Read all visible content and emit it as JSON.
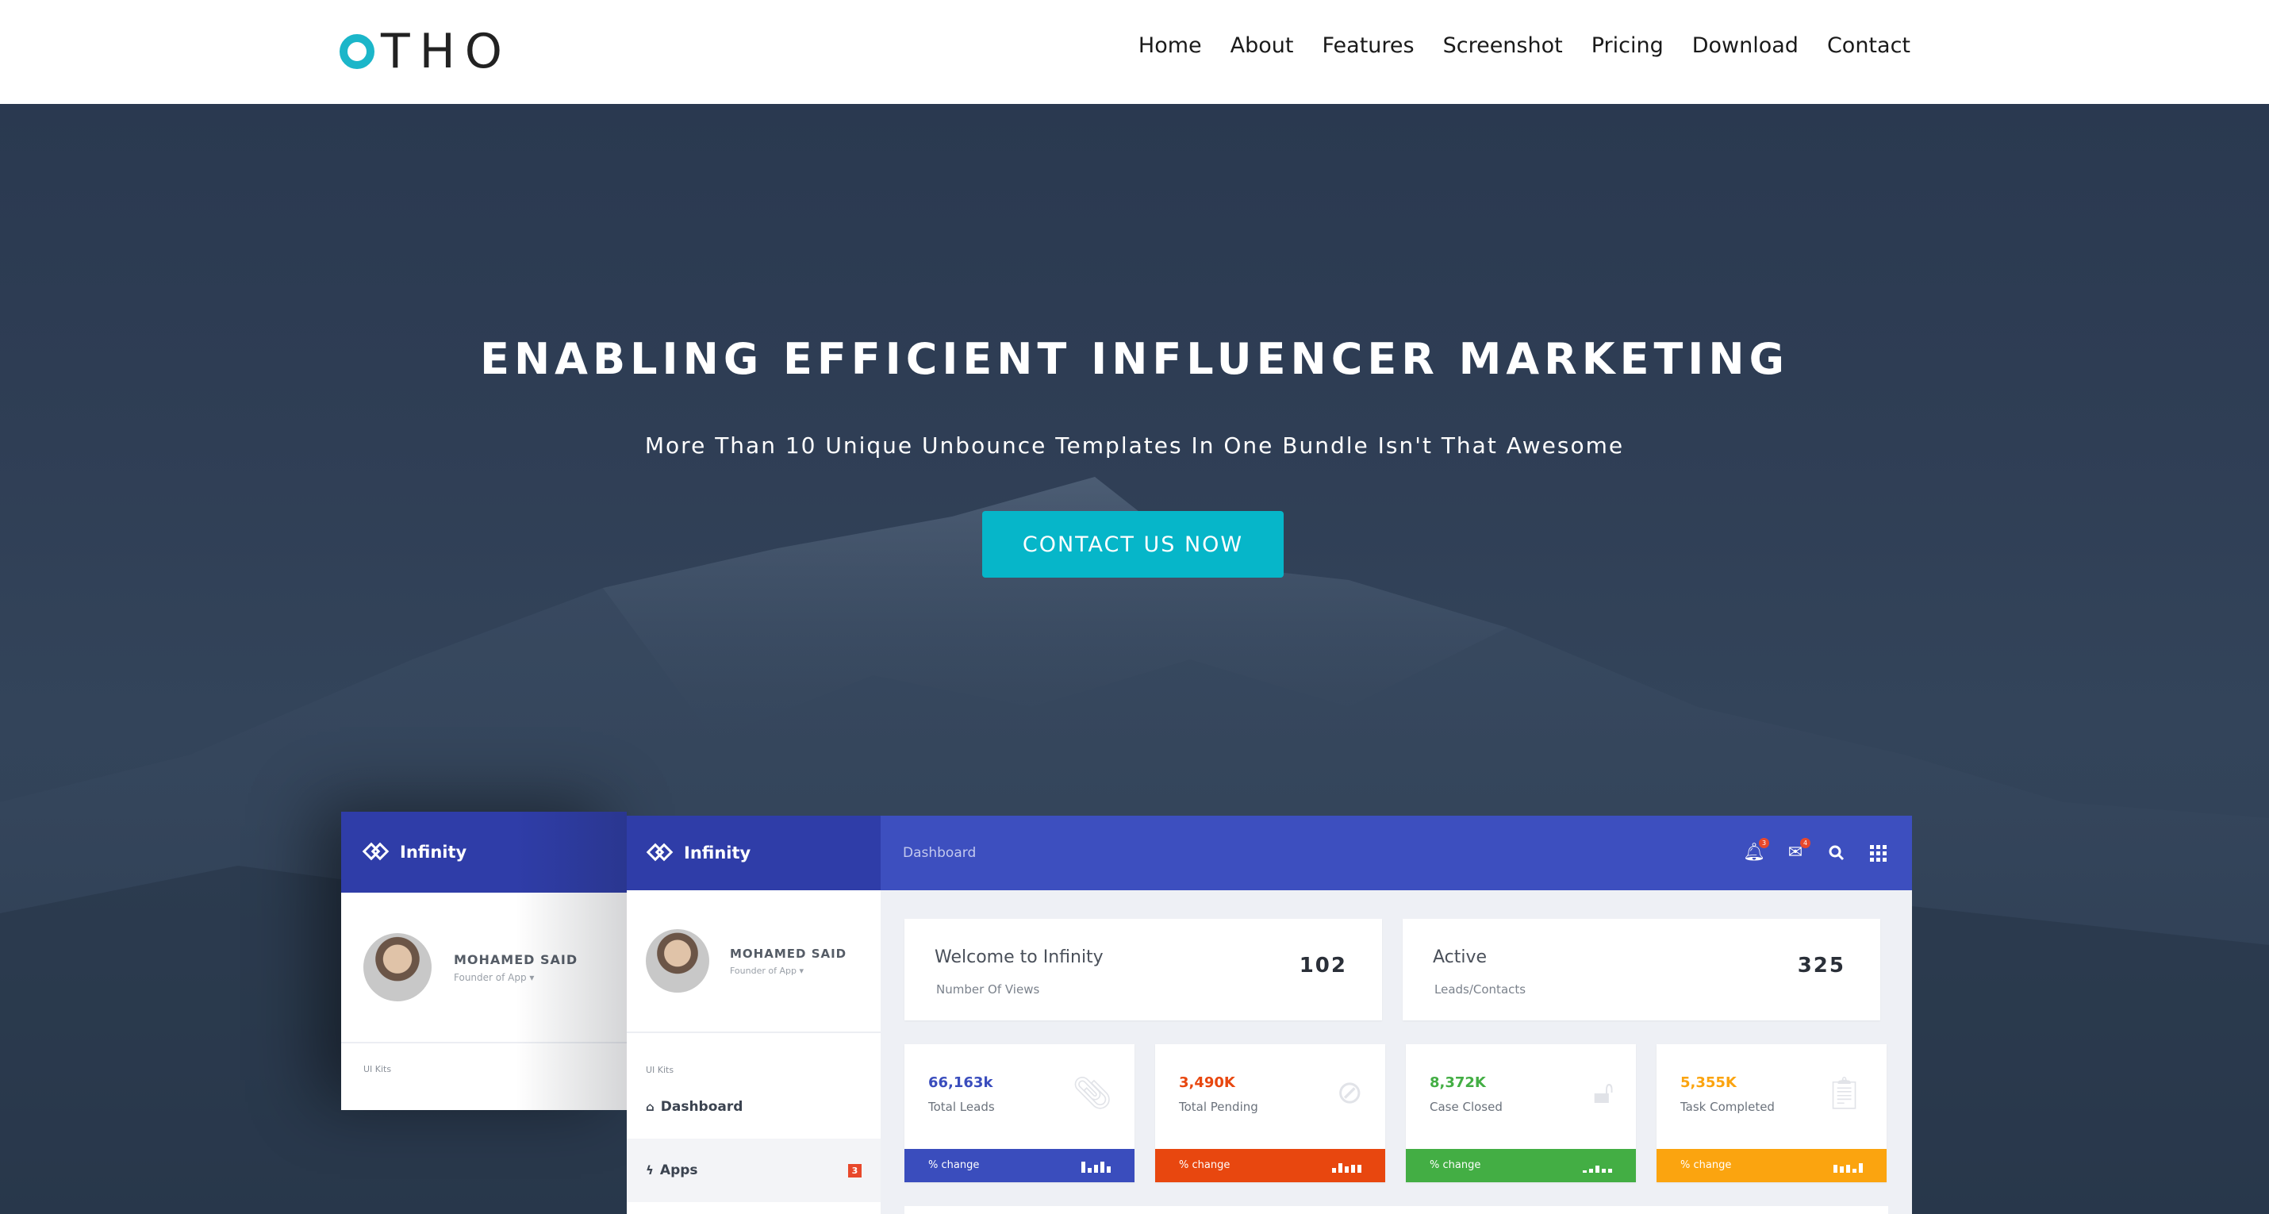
{
  "brand": {
    "logo_text": "THO",
    "accent": "#1bb6c9"
  },
  "nav": {
    "items": [
      {
        "label": "Home"
      },
      {
        "label": "About"
      },
      {
        "label": "Features"
      },
      {
        "label": "Screenshot"
      },
      {
        "label": "Pricing"
      },
      {
        "label": "Download"
      },
      {
        "label": "Contact"
      }
    ]
  },
  "hero": {
    "title": "ENABLING EFFICIENT INFLUENCER MARKETING",
    "subtitle": "More Than 10 Unique Unbounce Templates In One Bundle Isn't That Awesome",
    "cta_label": "CONTACT US NOW",
    "cta_color": "#06b6c9"
  },
  "dashboard": {
    "brand": "Infinity",
    "breadcrumb": "Dashboard",
    "notif_count": "3",
    "mail_count": "4",
    "profile": {
      "name": "MOHAMED SAID",
      "role": "Founder of App ▾"
    },
    "sidebar": {
      "section": "UI Kits",
      "items": [
        {
          "label": "Dashboard",
          "glyph": "⌂"
        },
        {
          "label": "Apps",
          "glyph": "ϟ",
          "badge": "3"
        }
      ]
    },
    "welcome_cards": [
      {
        "title": "Welcome to Infinity",
        "subtitle": "Number Of Views",
        "value": "102"
      },
      {
        "title": "Active",
        "subtitle": "Leads/Contacts",
        "value": "325"
      }
    ],
    "stat_cards": [
      {
        "value": "66,163k",
        "label": "Total Leads",
        "change": "% change",
        "color": "#3a4dbd",
        "icon": "paperclip-icon"
      },
      {
        "value": "3,490K",
        "label": "Total Pending",
        "change": "% change",
        "color": "#e8470f",
        "icon": "ban-icon"
      },
      {
        "value": "8,372K",
        "label": "Case Closed",
        "change": "% change",
        "color": "#43ae44",
        "icon": "lock-icon"
      },
      {
        "value": "5,355K",
        "label": "Task Completed",
        "change": "% change",
        "color": "#fba40f",
        "icon": "clipboard-icon"
      }
    ]
  }
}
